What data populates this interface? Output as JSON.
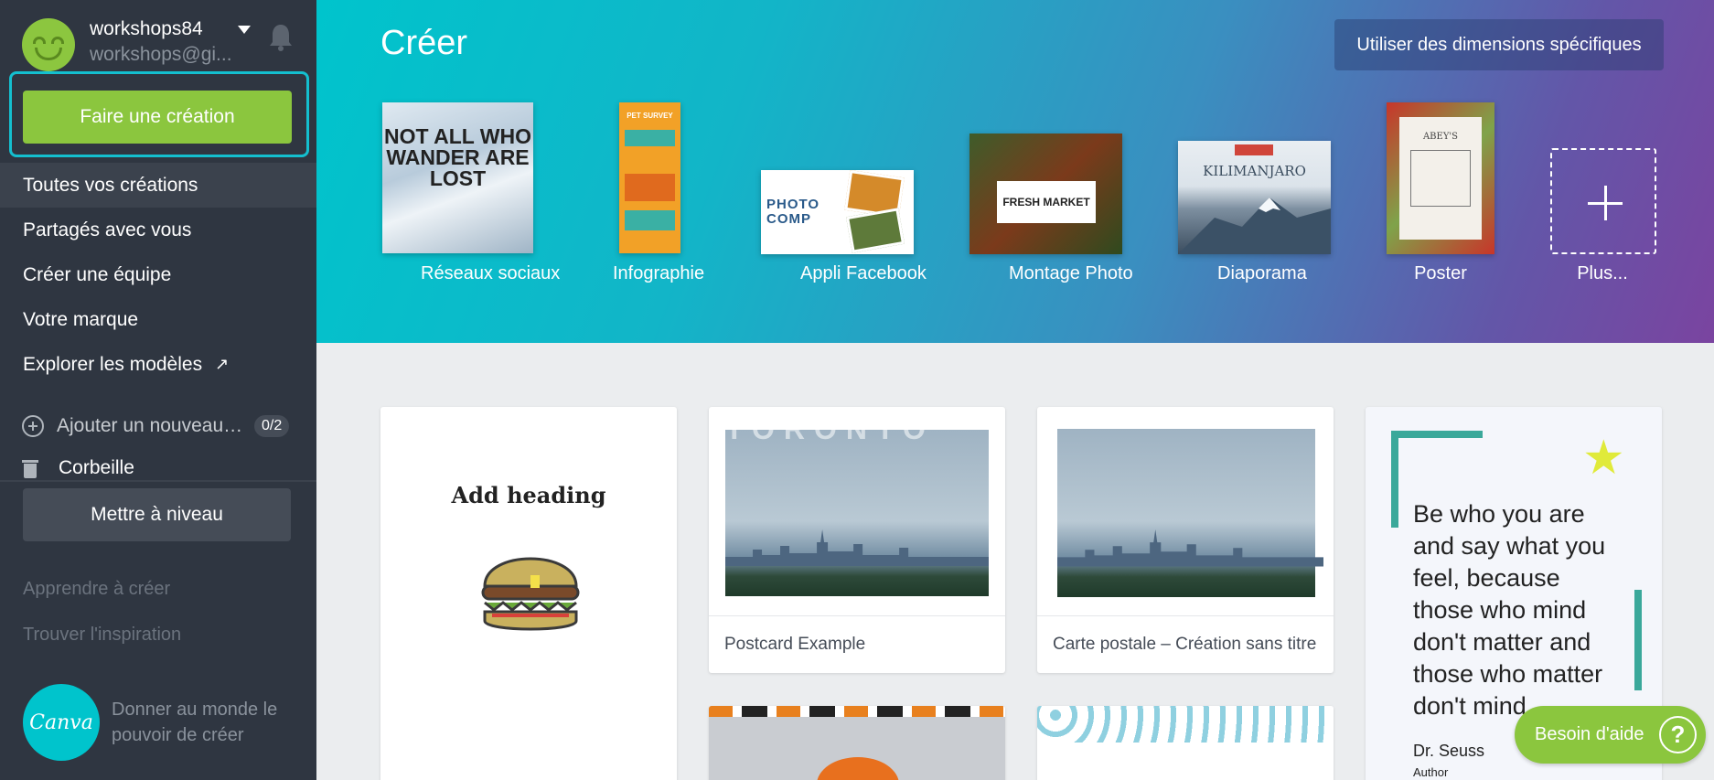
{
  "user": {
    "name": "workshops84",
    "email": "workshops@gi..."
  },
  "sidebar": {
    "create_button": "Faire une création",
    "items": [
      {
        "label": "Toutes vos créations"
      },
      {
        "label": "Partagés avec vous"
      },
      {
        "label": "Créer une équipe"
      },
      {
        "label": "Votre marque"
      },
      {
        "label": "Explorer les modèles"
      }
    ],
    "add_team_label": "Ajouter un nouveau d...",
    "add_team_count": "0/2",
    "trash_label": "Corbeille",
    "upgrade_button": "Mettre à niveau",
    "learn_link": "Apprendre à créer",
    "inspiration_link": "Trouver l'inspiration",
    "logo_text": "Canva",
    "tagline": "Donner au monde le pouvoir de créer"
  },
  "banner": {
    "title": "Créer",
    "custom_dimensions_button": "Utiliser des dimensions spécifiques",
    "templates": [
      {
        "label": "Réseaux sociaux",
        "thumb_text": "NOT ALL WHO WANDER ARE LOST"
      },
      {
        "label": "Infographie",
        "thumb_text": "PET SURVEY"
      },
      {
        "label": "Appli Facebook",
        "thumb_text": "PHOTO COMP"
      },
      {
        "label": "Montage Photo",
        "thumb_text": "FRESH MARKET"
      },
      {
        "label": "Diaporama",
        "thumb_text": "KILIMANJARO"
      },
      {
        "label": "Poster",
        "thumb_text": "ABEY'S"
      },
      {
        "label": "Plus..."
      }
    ]
  },
  "designs": [
    {
      "heading": "Add heading"
    },
    {
      "label": "Postcard Example",
      "overlay": "TORONTO"
    },
    {
      "label": "Carte postale – Création sans titre"
    },
    {
      "quote": "Be who you are and say what you feel, because those who mind don't matter and those who matter don't mind.",
      "author": "Dr. Seuss",
      "role": "Author"
    }
  ],
  "help_button": "Besoin d'aide",
  "colors": {
    "sidebar": "#2f3641",
    "accent_green": "#8bc63e",
    "accent_teal": "#00c4cc",
    "banner_end": "#7a44a0"
  }
}
